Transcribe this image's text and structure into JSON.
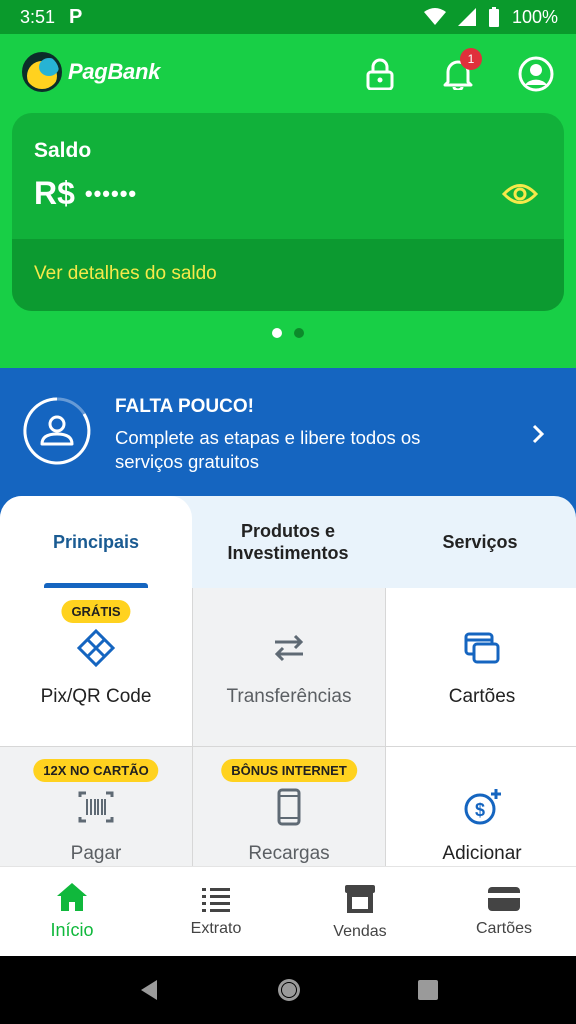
{
  "status_bar": {
    "time": "3:51",
    "app_badge": "P",
    "battery": "100%"
  },
  "header": {
    "brand": "PagBank",
    "notification_count": "1",
    "balance": {
      "label": "Saldo",
      "currency": "R$",
      "masked_value": "••••••",
      "details_link": "Ver detalhes do saldo"
    },
    "carousel": {
      "pages": 2,
      "active": 0
    }
  },
  "banner": {
    "title": "FALTA POUCO!",
    "text": "Complete as etapas e libere todos os serviços gratuitos"
  },
  "tabs": [
    {
      "label": "Principais",
      "active": true
    },
    {
      "label": "Produtos e Investimentos",
      "active": false
    },
    {
      "label": "Serviços",
      "active": false
    }
  ],
  "grid": [
    {
      "label": "Pix/QR Code",
      "badge": "GRÁTIS",
      "icon": "pix-icon"
    },
    {
      "label": "Transferências",
      "badge": "",
      "icon": "transfer-icon"
    },
    {
      "label": "Cartões",
      "badge": "",
      "icon": "cards-icon"
    },
    {
      "label": "Pagar",
      "badge": "12X NO CARTÃO",
      "icon": "barcode-icon"
    },
    {
      "label": "Recargas",
      "badge": "BÔNUS INTERNET",
      "icon": "phone-icon"
    },
    {
      "label": "Adicionar",
      "badge": "",
      "icon": "add-money-icon"
    }
  ],
  "bottom_nav": [
    {
      "label": "Início",
      "icon": "home-icon",
      "active": true
    },
    {
      "label": "Extrato",
      "icon": "list-icon",
      "active": false
    },
    {
      "label": "Vendas",
      "icon": "store-icon",
      "active": false
    },
    {
      "label": "Cartões",
      "icon": "card-icon",
      "active": false
    }
  ],
  "colors": {
    "header_green": "#18cf46",
    "card_green": "#11b13a",
    "banner_blue": "#1565c0",
    "badge_yellow": "#ffd21f",
    "icon_blue": "#1565c0",
    "nav_active": "#10b83c"
  }
}
